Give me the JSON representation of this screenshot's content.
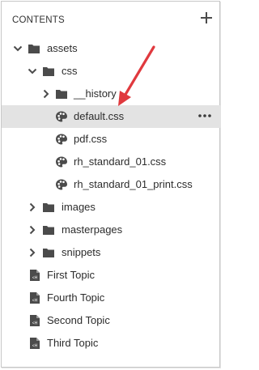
{
  "panel": {
    "title": "CONTENTS",
    "add_icon": "plus-icon",
    "more_icon": "more-horizontal-icon"
  },
  "tree": [
    {
      "label": "assets",
      "type": "folder",
      "expanded": true,
      "depth": 0
    },
    {
      "label": "css",
      "type": "folder",
      "expanded": true,
      "depth": 1
    },
    {
      "label": "__history",
      "type": "folder",
      "expanded": false,
      "depth": 2
    },
    {
      "label": "default.css",
      "type": "css",
      "depth": 2,
      "selected": true
    },
    {
      "label": "pdf.css",
      "type": "css",
      "depth": 2
    },
    {
      "label": "rh_standard_01.css",
      "type": "css",
      "depth": 2
    },
    {
      "label": "rh_standard_01_print.css",
      "type": "css",
      "depth": 2
    },
    {
      "label": "images",
      "type": "folder",
      "expanded": false,
      "depth": 1
    },
    {
      "label": "masterpages",
      "type": "folder",
      "expanded": false,
      "depth": 1
    },
    {
      "label": "snippets",
      "type": "folder",
      "expanded": false,
      "depth": 1
    },
    {
      "label": "First Topic",
      "type": "topic",
      "depth": 0
    },
    {
      "label": "Fourth Topic",
      "type": "topic",
      "depth": 0
    },
    {
      "label": "Second Topic",
      "type": "topic",
      "depth": 0
    },
    {
      "label": "Third Topic",
      "type": "topic",
      "depth": 0
    }
  ],
  "colors": {
    "icon": "#4b4b4b",
    "selected_bg": "#e3e3e3",
    "annotation_arrow": "#e0393e"
  }
}
